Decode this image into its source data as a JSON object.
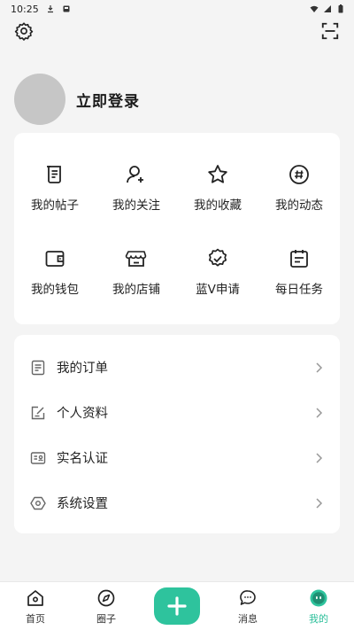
{
  "status_bar": {
    "time": "10:25"
  },
  "top_bar": {
    "settings_icon": "gear-icon",
    "scan_icon": "scan-icon"
  },
  "profile": {
    "login_label": "立即登录"
  },
  "grid": [
    {
      "label": "我的帖子",
      "icon": "post-icon"
    },
    {
      "label": "我的关注",
      "icon": "follow-icon"
    },
    {
      "label": "我的收藏",
      "icon": "star-icon"
    },
    {
      "label": "我的动态",
      "icon": "hashtag-icon"
    },
    {
      "label": "我的钱包",
      "icon": "wallet-icon"
    },
    {
      "label": "我的店铺",
      "icon": "store-icon"
    },
    {
      "label": "蓝V申请",
      "icon": "verified-badge-icon"
    },
    {
      "label": "每日任务",
      "icon": "calendar-icon"
    }
  ],
  "list": [
    {
      "label": "我的订单",
      "icon": "order-icon"
    },
    {
      "label": "个人资料",
      "icon": "edit-profile-icon"
    },
    {
      "label": "实名认证",
      "icon": "id-card-icon"
    },
    {
      "label": "系统设置",
      "icon": "hexagon-settings-icon"
    }
  ],
  "tabs": [
    {
      "label": "首页",
      "icon": "home-icon"
    },
    {
      "label": "圈子",
      "icon": "compass-icon"
    },
    {
      "label": "消息",
      "icon": "chat-icon"
    },
    {
      "label": "我的",
      "icon": "face-icon"
    }
  ],
  "colors": {
    "accent": "#2ec39d",
    "background": "#f4f4f4",
    "card": "#ffffff"
  }
}
